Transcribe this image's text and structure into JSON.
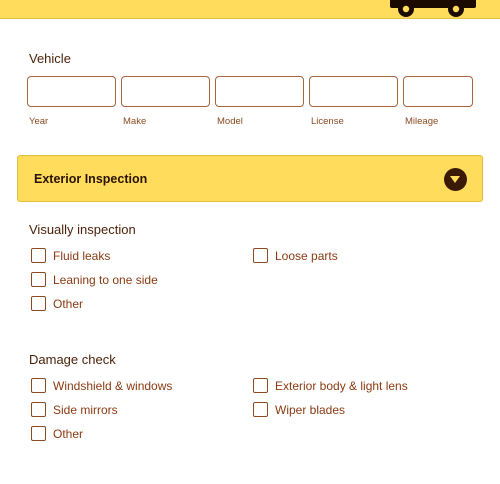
{
  "vehicle": {
    "title": "Vehicle",
    "fields": [
      {
        "label": "Year",
        "value": ""
      },
      {
        "label": "Make",
        "value": ""
      },
      {
        "label": "Model",
        "value": ""
      },
      {
        "label": "License",
        "value": ""
      },
      {
        "label": "Mileage",
        "value": ""
      }
    ]
  },
  "accordion": {
    "title": "Exterior Inspection",
    "toggle_icon": "chevron-down-icon",
    "expanded": true
  },
  "visual_inspection": {
    "title": "Visually inspection",
    "options": [
      "Fluid leaks",
      "Loose parts",
      "Leaning to one side",
      "Other"
    ]
  },
  "damage_check": {
    "title": "Damage check",
    "options": [
      "Windshield & windows",
      "Exterior body & light lens",
      "Side mirrors",
      "Wiper blades",
      "Other"
    ]
  },
  "colors": {
    "accent_yellow": "#ffdc5c",
    "text_brown": "#5a2a0c",
    "border_brown": "#a8643c"
  }
}
